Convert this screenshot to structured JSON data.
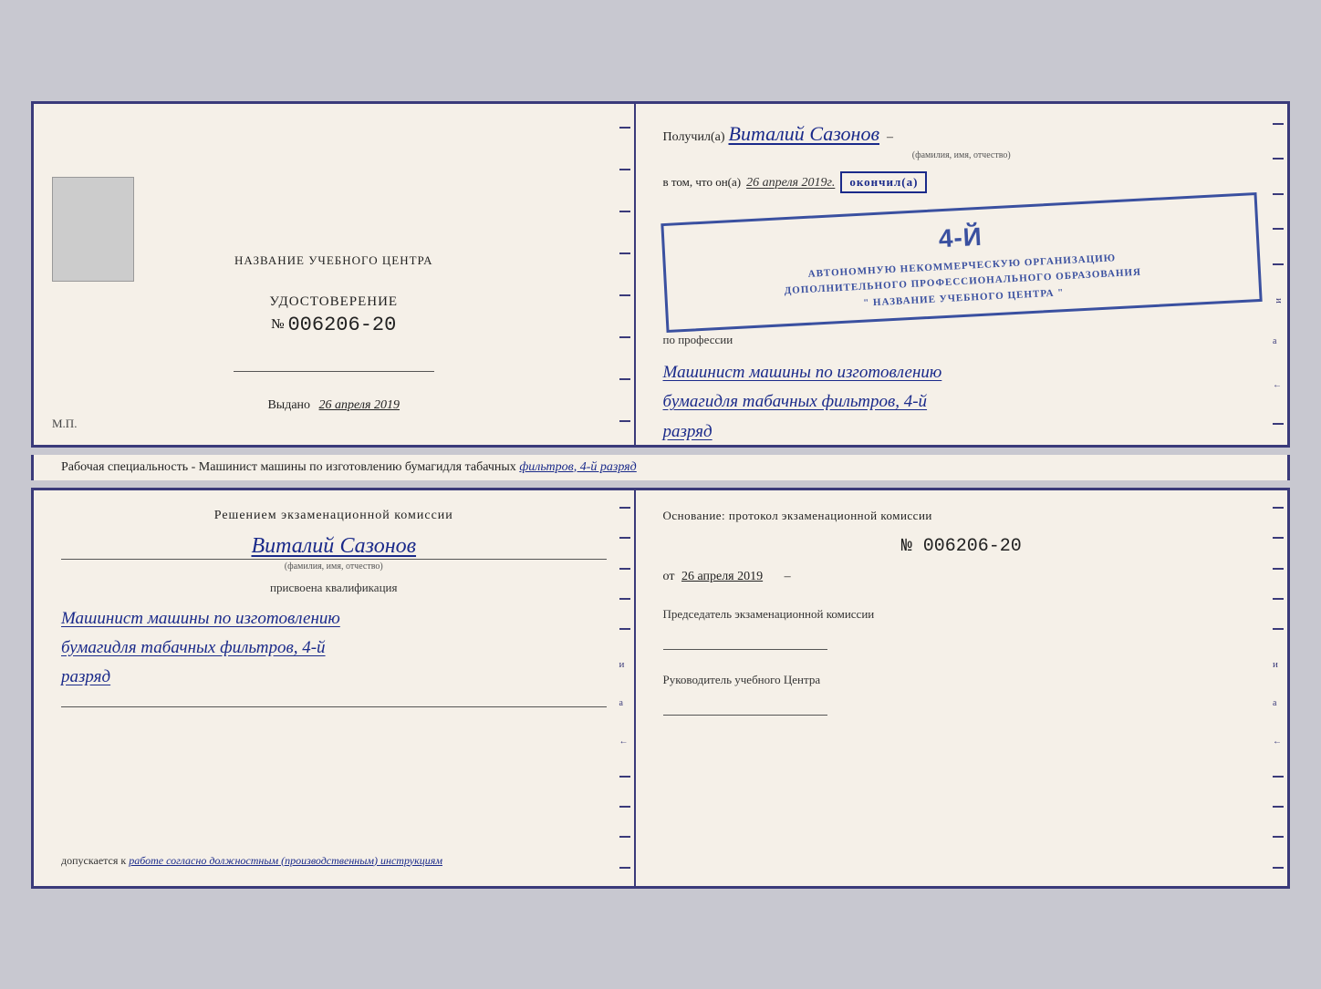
{
  "top_left": {
    "center_label": "НАЗВАНИЕ УЧЕБНОГО ЦЕНТРА",
    "udostoverenie": "УДОСТОВЕРЕНИЕ",
    "number_prefix": "№",
    "number": "006206-20",
    "vydano_label": "Выдано",
    "vydano_date": "26 апреля 2019",
    "mp": "М.П."
  },
  "top_right": {
    "poluchil_label": "Получил(а)",
    "recipient_name": "Виталий Сазонов",
    "fio_label": "(фамилия, имя, отчество)",
    "vtom_label": "в том, что он(а)",
    "date_handwritten": "26 апреля 2019г.",
    "okonchil_label": "окончил(а)",
    "stamp_number": "4-й",
    "stamp_line1": "АВТОНОМНУЮ НЕКОММЕРЧЕСКУЮ ОРГАНИЗАЦИЮ",
    "stamp_line2": "ДОПОЛНИТЕЛЬНОГО ПРОФЕССИОНАЛЬНОГО ОБРАЗОВАНИЯ",
    "stamp_line3": "\" НАЗВАНИЕ УЧЕБНОГО ЦЕНТРА \"",
    "po_professii": "по профессии",
    "profession_line1": "Машинист машины по изготовлению",
    "profession_line2": "бумагидля табачных фильтров, 4-й",
    "profession_line3": "разряд"
  },
  "middle": {
    "text_start": "Рабочая специальность - Машинист машины по изготовлению бумагидля табачных",
    "text_underlined": "фильтров, 4-й разряд"
  },
  "bottom_left": {
    "resheniem": "Решением экзаменационной комиссии",
    "name": "Виталий Сазонов",
    "fio_label": "(фамилия, имя, отчество)",
    "prisvoena": "присвоена квалификация",
    "qualification_line1": "Машинист машины по изготовлению",
    "qualification_line2": "бумагидля табачных фильтров, 4-й",
    "qualification_line3": "разряд",
    "dopuskaetsya": "допускается к",
    "dopuskaetsya_text": "работе согласно должностным (производственным) инструкциям"
  },
  "bottom_right": {
    "osnovanie": "Основание: протокол экзаменационной комиссии",
    "number_prefix": "№",
    "number": "006206-20",
    "ot_prefix": "от",
    "ot_date": "26 апреля 2019",
    "predsedatel_label": "Председатель экзаменационной комиссии",
    "rukovoditel_label": "Руководитель учебного Центра"
  }
}
